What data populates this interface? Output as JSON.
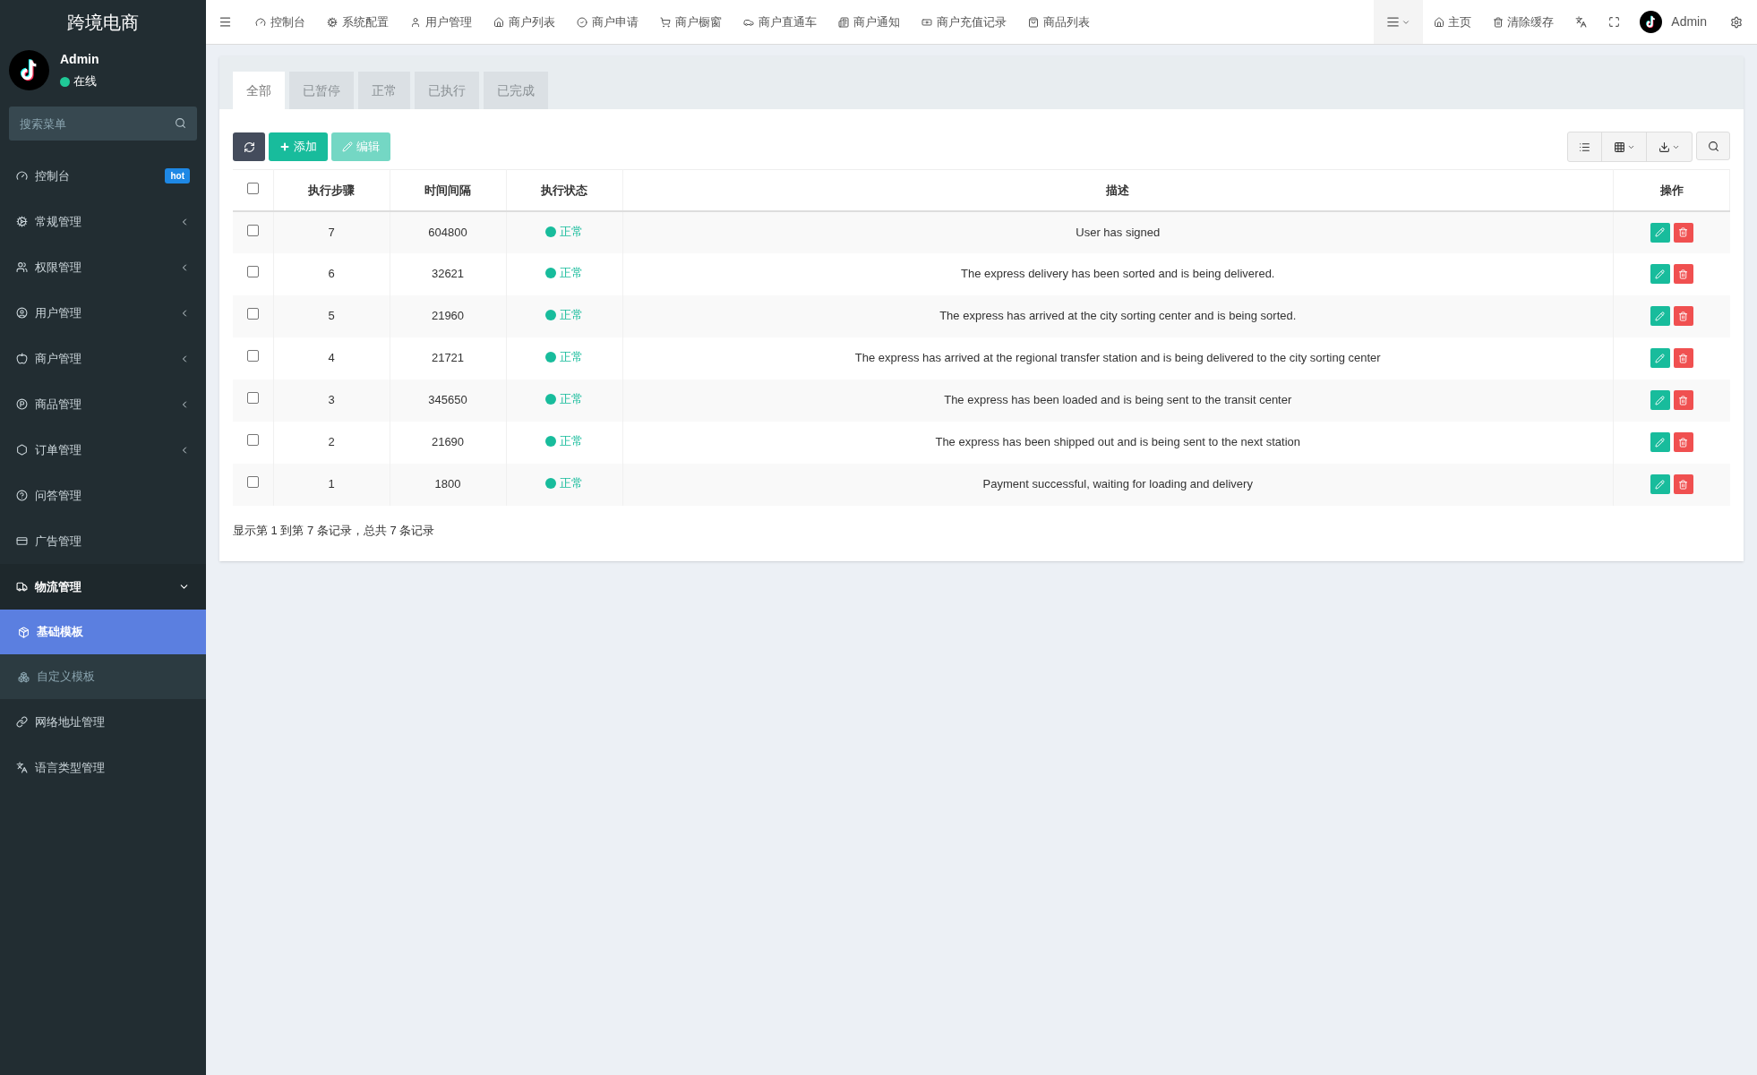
{
  "sidebar": {
    "brand": "跨境电商",
    "user": {
      "name": "Admin",
      "status": "在线"
    },
    "search": {
      "placeholder": "搜索菜单"
    },
    "items": [
      {
        "label": "控制台",
        "badge": "hot",
        "selected": false
      },
      {
        "label": "常规管理",
        "expanded": false,
        "selected": false
      },
      {
        "label": "权限管理",
        "expanded": false,
        "selected": false
      },
      {
        "label": "用户管理",
        "expanded": false,
        "selected": false
      },
      {
        "label": "商户管理",
        "expanded": false,
        "selected": false
      },
      {
        "label": "商品管理",
        "expanded": false,
        "selected": false
      },
      {
        "label": "订单管理",
        "expanded": false,
        "selected": false
      },
      {
        "label": "问答管理",
        "selected": false
      },
      {
        "label": "广告管理",
        "selected": false
      },
      {
        "label": "物流管理",
        "expanded": true,
        "selected": false,
        "children": [
          {
            "label": "基础模板",
            "selected": true
          },
          {
            "label": "自定义模板",
            "selected": false
          }
        ]
      },
      {
        "label": "网络地址管理",
        "selected": false
      },
      {
        "label": "语言类型管理",
        "selected": false
      }
    ]
  },
  "topnav": {
    "items": [
      "控制台",
      "系统配置",
      "用户管理",
      "商户列表",
      "商户申请",
      "商户橱窗",
      "商户直通车",
      "商户通知",
      "商户充值记录",
      "商品列表"
    ],
    "right": [
      "主页",
      "清除缓存"
    ],
    "user": "Admin"
  },
  "tabs": [
    {
      "label": "全部",
      "selected": true
    },
    {
      "label": "已暂停",
      "selected": false
    },
    {
      "label": "正常",
      "selected": false
    },
    {
      "label": "已执行",
      "selected": false
    },
    {
      "label": "已完成",
      "selected": false
    }
  ],
  "toolbar": {
    "add": "添加",
    "edit": "编辑"
  },
  "table": {
    "columns": [
      "执行步骤",
      "时间间隔",
      "执行状态",
      "描述",
      "操作"
    ],
    "header_checked": false,
    "rows": [
      {
        "checked": false,
        "step": "7",
        "interval": "604800",
        "status": "正常",
        "description": "User has signed"
      },
      {
        "checked": false,
        "step": "6",
        "interval": "32621",
        "status": "正常",
        "description": "The express delivery has been sorted and is being delivered."
      },
      {
        "checked": false,
        "step": "5",
        "interval": "21960",
        "status": "正常",
        "description": "The express has arrived at the city sorting center and is being sorted."
      },
      {
        "checked": false,
        "step": "4",
        "interval": "21721",
        "status": "正常",
        "description": "The express has arrived at the regional transfer station and is being delivered to the city sorting center"
      },
      {
        "checked": false,
        "step": "3",
        "interval": "345650",
        "status": "正常",
        "description": "The express has been loaded and is being sent to the transit center"
      },
      {
        "checked": false,
        "step": "2",
        "interval": "21690",
        "status": "正常",
        "description": "The express has been shipped out and is being sent to the next station"
      },
      {
        "checked": false,
        "step": "1",
        "interval": "1800",
        "status": "正常",
        "description": "Payment successful, waiting for loading and delivery"
      }
    ]
  },
  "pagination": "显示第 1 到第 7 条记录，总共 7 条记录"
}
